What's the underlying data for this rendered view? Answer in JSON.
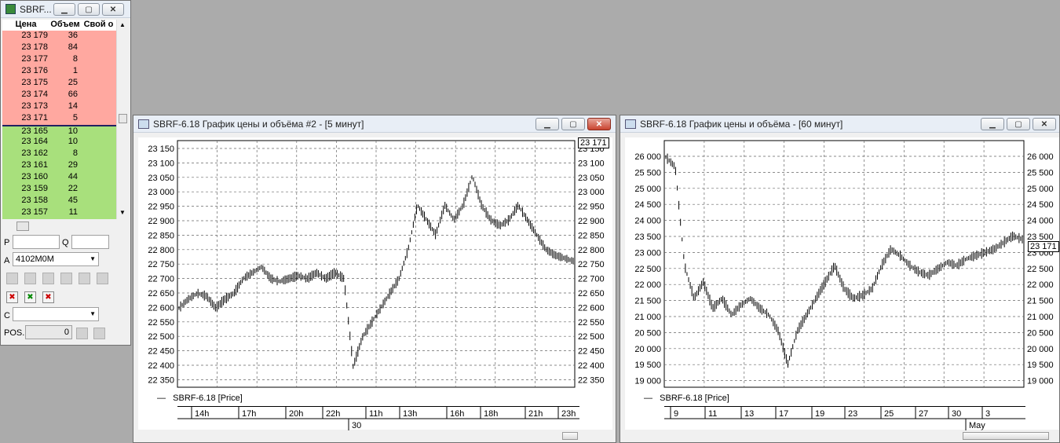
{
  "book": {
    "title": "SBRF...",
    "headers": [
      "Цена",
      "Объем",
      "Свой о"
    ],
    "asks": [
      [
        "23 179",
        "36"
      ],
      [
        "23 178",
        "84"
      ],
      [
        "23 177",
        "8"
      ],
      [
        "23 176",
        "1"
      ],
      [
        "23 175",
        "25"
      ],
      [
        "23 174",
        "66"
      ],
      [
        "23 173",
        "14"
      ],
      [
        "23 171",
        "5"
      ]
    ],
    "bids": [
      [
        "23 165",
        "10"
      ],
      [
        "23 164",
        "10"
      ],
      [
        "23 162",
        "8"
      ],
      [
        "23 161",
        "29"
      ],
      [
        "23 160",
        "44"
      ],
      [
        "23 159",
        "22"
      ],
      [
        "23 158",
        "45"
      ],
      [
        "23 157",
        "11"
      ]
    ],
    "p_label": "P",
    "q_label": "Q",
    "a_label": "A",
    "account_value": "4102M0M",
    "c_label": "C",
    "pos_label": "POS.",
    "pos_value": "0"
  },
  "chart5": {
    "title": "SBRF-6.18 График цены и объёма #2 - [5 минут]",
    "legend": "SBRF-6.18 [Price]",
    "current_price": "23 171",
    "yticks": [
      "23 150",
      "23 100",
      "23 050",
      "23 000",
      "22 950",
      "22 900",
      "22 850",
      "22 800",
      "22 750",
      "22 700",
      "22 650",
      "22 600",
      "22 550",
      "22 500",
      "22 450",
      "22 400",
      "22 350"
    ],
    "xlabels": [
      "14h",
      "17h",
      "20h",
      "22h",
      "11h",
      "13h",
      "16h",
      "18h",
      "21h",
      "23h"
    ],
    "day_label": "30"
  },
  "chart60": {
    "title": "SBRF-6.18 График цены и объёма - [60 минут]",
    "legend": "SBRF-6.18 [Price]",
    "current_price": "23 171",
    "yticks": [
      "26 000",
      "25 500",
      "25 000",
      "24 500",
      "24 000",
      "23 500",
      "23 000",
      "22 500",
      "22 000",
      "21 500",
      "21 000",
      "20 500",
      "20 000",
      "19 500",
      "19 000"
    ],
    "xlabels": [
      "9",
      "11",
      "13",
      "17",
      "19",
      "23",
      "25",
      "27",
      "30",
      "3"
    ],
    "month_label": "May"
  },
  "chart_data": [
    {
      "type": "ohlc",
      "series": [
        {
          "name": "SBRF-6.18 [Price]",
          "values": [
            22600,
            22630,
            22650,
            22640,
            22600,
            22630,
            22650,
            22700,
            22720,
            22740,
            22700,
            22690,
            22700,
            22710,
            22700,
            22720,
            22700,
            22720,
            22700,
            22400,
            22500,
            22550,
            22600,
            22650,
            22700,
            22800,
            22950,
            22900,
            22850,
            22950,
            22900,
            22950,
            23050,
            22950,
            22900,
            22880,
            22900,
            22950,
            22900,
            22850,
            22800,
            22780,
            22770,
            22760
          ]
        }
      ],
      "ylim": [
        22330,
        23170
      ]
    },
    {
      "type": "ohlc",
      "series": [
        {
          "name": "SBRF-6.18 [Price]",
          "values": [
            25800,
            25500,
            22500,
            21500,
            22000,
            21200,
            21500,
            21000,
            21300,
            21500,
            21200,
            21000,
            20500,
            19500,
            20500,
            21000,
            21500,
            22000,
            22500,
            21800,
            21500,
            21600,
            21800,
            22500,
            23000,
            22800,
            22500,
            22300,
            22200,
            22400,
            22600,
            22500,
            22700,
            22800,
            22900,
            23000,
            23200,
            23400,
            23300
          ]
        }
      ],
      "ylim": [
        18800,
        26300
      ]
    }
  ]
}
